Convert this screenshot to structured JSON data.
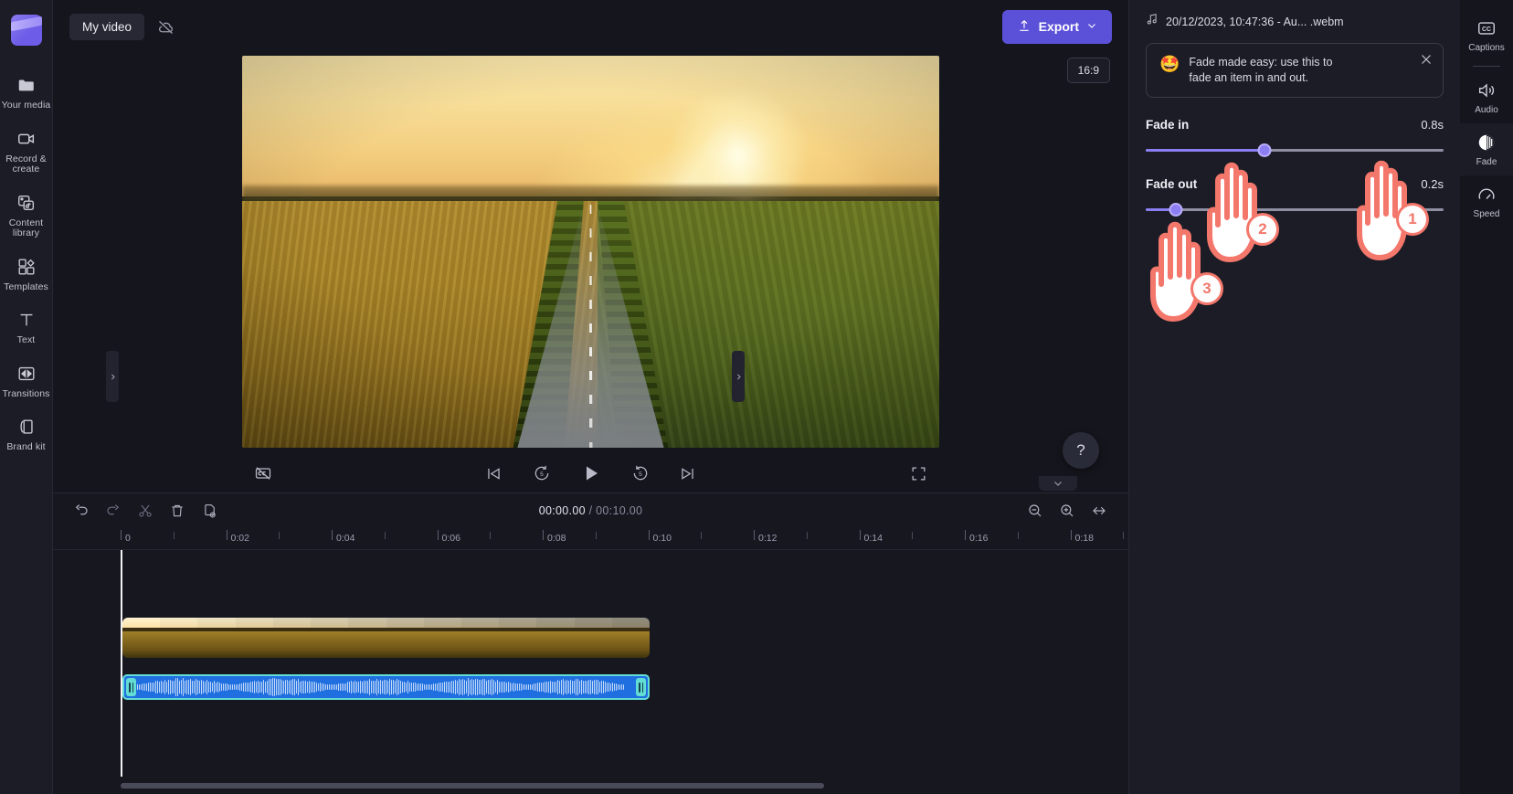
{
  "app": {
    "project_title": "My video",
    "cloud_icon": "cloud-off-icon",
    "export_label": "Export",
    "export_icon": "upload-arrow-icon",
    "aspect_ratio": "16:9"
  },
  "sidebar": {
    "items": [
      {
        "label": "Your media",
        "icon": "folder-icon"
      },
      {
        "label": "Record & create",
        "icon": "video-camera-icon"
      },
      {
        "label": "Content library",
        "icon": "content-library-icon"
      },
      {
        "label": "Templates",
        "icon": "templates-icon"
      },
      {
        "label": "Text",
        "icon": "text-t-icon"
      },
      {
        "label": "Transitions",
        "icon": "transitions-icon"
      },
      {
        "label": "Brand kit",
        "icon": "brand-kit-icon"
      }
    ]
  },
  "player": {
    "captions_toggle_icon": "captions-off-icon",
    "skip_start_icon": "skip-to-start-icon",
    "rewind_label": "5",
    "play_icon": "play-icon",
    "forward_label": "5",
    "skip_end_icon": "skip-to-end-icon",
    "fullscreen_icon": "fullscreen-icon",
    "help_label": "?"
  },
  "timeline": {
    "tools": [
      {
        "name": "undo",
        "icon": "undo-icon",
        "enabled": true
      },
      {
        "name": "redo",
        "icon": "redo-icon",
        "enabled": false
      },
      {
        "name": "split",
        "icon": "scissors-icon",
        "enabled": false
      },
      {
        "name": "delete",
        "icon": "trash-icon",
        "enabled": true
      },
      {
        "name": "duplicate",
        "icon": "duplicate-icon",
        "enabled": true
      }
    ],
    "current_time": "00:00.00",
    "separator": "/",
    "total_time": "00:10.00",
    "zoom_out_icon": "zoom-out-icon",
    "zoom_in_icon": "zoom-in-icon",
    "fit_icon": "fit-to-screen-icon",
    "ruler_labels": [
      "0",
      "0:02",
      "0:04",
      "0:06",
      "0:08",
      "0:10",
      "0:12",
      "0:14",
      "0:16",
      "0:18"
    ],
    "video_clip_name": "video-clip",
    "audio_clip_name": "audio-clip-selected"
  },
  "properties": {
    "file_name": "20/12/2023, 10:47:36 - Au... .webm",
    "file_icon": "music-note-icon",
    "tip": {
      "emoji": "🤩",
      "text": "Fade made easy: use this to fade an item in and out.",
      "close_icon": "close-icon"
    },
    "fade_in": {
      "label": "Fade in",
      "value": "0.8s",
      "percent": 40
    },
    "fade_out": {
      "label": "Fade out",
      "value": "0.2s",
      "percent": 10
    }
  },
  "right_rail": {
    "items": [
      {
        "label": "Captions",
        "icon": "cc-icon",
        "active": false
      },
      {
        "label": "Audio",
        "icon": "speaker-icon",
        "active": false
      },
      {
        "label": "Fade",
        "icon": "fade-icon",
        "active": true
      },
      {
        "label": "Speed",
        "icon": "speed-icon",
        "active": false
      }
    ]
  },
  "annotations": {
    "steps": [
      {
        "number": "1",
        "target": "fade-rail-button"
      },
      {
        "number": "2",
        "target": "fade-in-slider"
      },
      {
        "number": "3",
        "target": "fade-out-slider"
      }
    ]
  }
}
